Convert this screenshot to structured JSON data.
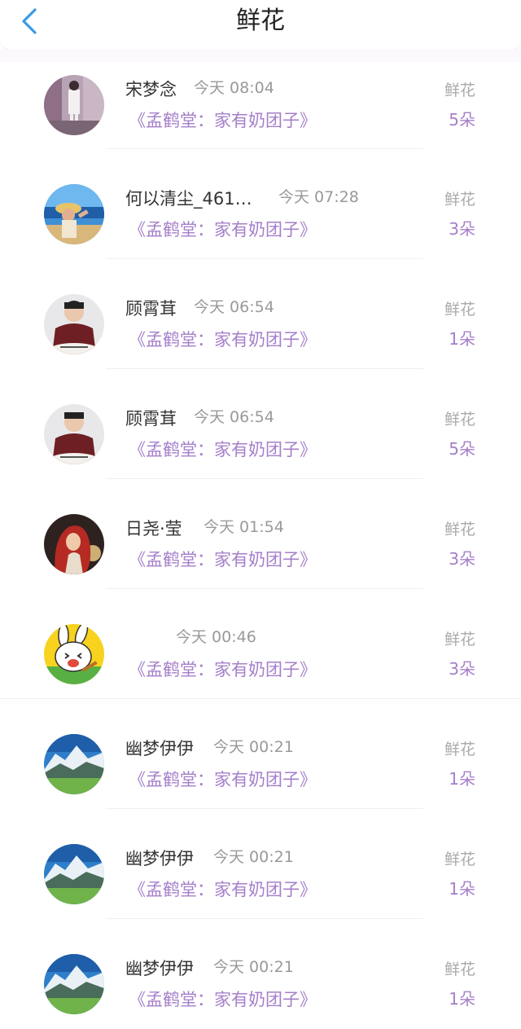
{
  "header": {
    "title": "鲜花",
    "back_icon": "chevron-left-icon"
  },
  "rows": [
    {
      "name": "宋梦念",
      "time": "今天 08:04",
      "book": "《孟鹤堂：家有奶团子》",
      "gift": "鲜花",
      "count": "5朵",
      "avatar": "avatar-room-photo"
    },
    {
      "name": "何以清尘_461…",
      "time": "今天 07:28",
      "book": "《孟鹤堂：家有奶团子》",
      "gift": "鲜花",
      "count": "3朵",
      "avatar": "avatar-beach-photo"
    },
    {
      "name": "顾霄茸",
      "time": "今天 06:54",
      "book": "《孟鹤堂：家有奶团子》",
      "gift": "鲜花",
      "count": "1朵",
      "avatar": "avatar-person-photo"
    },
    {
      "name": "顾霄茸",
      "time": "今天 06:54",
      "book": "《孟鹤堂：家有奶团子》",
      "gift": "鲜花",
      "count": "5朵",
      "avatar": "avatar-person-photo"
    },
    {
      "name": "日尧·莹",
      "time": "今天 01:54",
      "book": "《孟鹤堂：家有奶团子》",
      "gift": "鲜花",
      "count": "3朵",
      "avatar": "avatar-red-hair-art"
    },
    {
      "name": "",
      "time": "今天 00:46",
      "book": "《孟鹤堂：家有奶团子》",
      "gift": "鲜花",
      "count": "3朵",
      "avatar": "avatar-cartoon-rabbit"
    },
    {
      "name": "幽梦伊伊",
      "time": "今天 00:21",
      "book": "《孟鹤堂：家有奶团子》",
      "gift": "鲜花",
      "count": "1朵",
      "avatar": "avatar-mountain-photo"
    },
    {
      "name": "幽梦伊伊",
      "time": "今天 00:21",
      "book": "《孟鹤堂：家有奶团子》",
      "gift": "鲜花",
      "count": "1朵",
      "avatar": "avatar-mountain-photo"
    },
    {
      "name": "幽梦伊伊",
      "time": "今天 00:21",
      "book": "《孟鹤堂：家有奶团子》",
      "gift": "鲜花",
      "count": "1朵",
      "avatar": "avatar-mountain-photo"
    }
  ],
  "colors": {
    "accent": "#a57fca",
    "back": "#3a9ae6",
    "muted": "#999999"
  }
}
